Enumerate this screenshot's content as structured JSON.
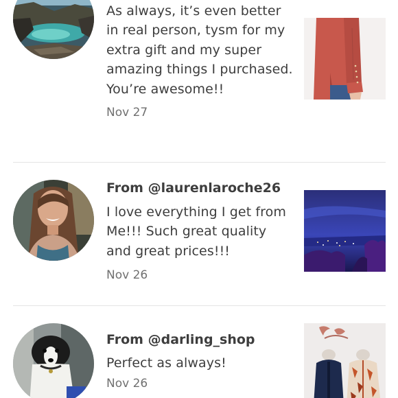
{
  "reviews": [
    {
      "from": "",
      "message": "As always, it’s even better in real person, tysm for my extra gift and my super amazing things I purchased. You’re awesome!!",
      "date": "Nov 27"
    },
    {
      "from": "From @laurenlaroche26",
      "message": "I love everything I get from Me!!! Such great quality and great prices!!!",
      "date": "Nov 26"
    },
    {
      "from": "From @darling_shop",
      "message": "Perfect as always!",
      "date": "Nov 26"
    }
  ]
}
